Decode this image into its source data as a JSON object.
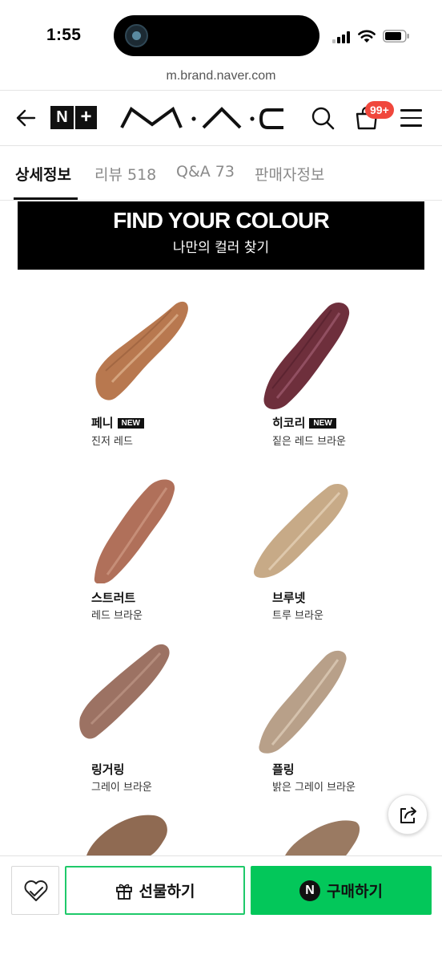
{
  "status_bar": {
    "time": "1:55"
  },
  "browser": {
    "url": "m.brand.naver.com"
  },
  "header": {
    "nplus_n": "N",
    "nplus_plus": "+",
    "brand_logo": "M·A·C",
    "cart_badge": "99+",
    "icons": [
      "back-arrow-icon",
      "search-icon",
      "shopping-bag-icon",
      "hamburger-menu-icon"
    ]
  },
  "tabs": [
    {
      "label": "상세정보",
      "active": true
    },
    {
      "label": "리뷰 518",
      "active": false
    },
    {
      "label": "Q&A 73",
      "active": false
    },
    {
      "label": "판매자정보",
      "active": false
    }
  ],
  "banner": {
    "title": "FIND YOUR COLOUR",
    "subtitle": "나만의 컬러 찾기"
  },
  "swatches": [
    {
      "name": "페니",
      "new_badge": "NEW",
      "desc": "진저 레드",
      "color": "#b8784f"
    },
    {
      "name": "히코리",
      "new_badge": "NEW",
      "desc": "짙은 레드 브라운",
      "color": "#6e2f3c"
    },
    {
      "name": "스트러트",
      "new_badge": "",
      "desc": "레드 브라운",
      "color": "#b0705a"
    },
    {
      "name": "브루넷",
      "new_badge": "",
      "desc": "트루 브라운",
      "color": "#c7aa87"
    },
    {
      "name": "링거링",
      "new_badge": "",
      "desc": "그레이 브라운",
      "color": "#9c7263"
    },
    {
      "name": "플링",
      "new_badge": "",
      "desc": "밝은 그레이 브라운",
      "color": "#b8a089"
    }
  ],
  "bottom_bar": {
    "gift_label": "선물하기",
    "buy_label": "구매하기",
    "buy_n": "N",
    "colors": {
      "naver_green": "#03c75a",
      "badge_red": "#f0473c"
    }
  }
}
